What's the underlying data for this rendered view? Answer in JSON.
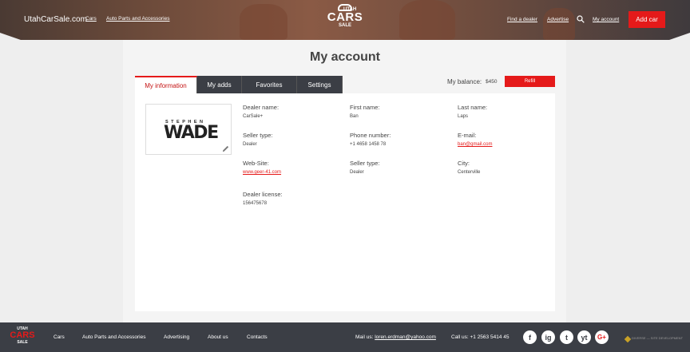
{
  "header": {
    "site_name": "UtahCarSale.com",
    "nav": [
      "Cars",
      "Auto Parts and Accessories"
    ],
    "logo": {
      "top": "UTAH",
      "main": "CARS",
      "bottom": "SALE"
    },
    "right_nav": {
      "find_dealer": "Find a dealer",
      "advertise": "Advertise",
      "my_account": "My account"
    },
    "add_car_label": "Add car"
  },
  "page": {
    "title": "My account"
  },
  "tabs": [
    {
      "label": "My information",
      "active": true
    },
    {
      "label": "My adds"
    },
    {
      "label": "Favorites"
    },
    {
      "label": "Settings"
    }
  ],
  "balance": {
    "label": "My balance:",
    "value": "$450",
    "refill_label": "Refill"
  },
  "avatar": {
    "top_text": "STEPHEN",
    "main_text": "WADE"
  },
  "fields": {
    "dealer_name": {
      "label": "Dealer name:",
      "value": "CarSale+"
    },
    "first_name": {
      "label": "First name:",
      "value": "Ban"
    },
    "last_name": {
      "label": "Last name:",
      "value": "Laps"
    },
    "seller_type_1": {
      "label": "Seller type:",
      "value": "Dealer"
    },
    "phone": {
      "label": "Phone number:",
      "value": "+1 4658 1458 78"
    },
    "email": {
      "label": "E-mail:",
      "value": "ban@gmail.com"
    },
    "website": {
      "label": "Web-Site:",
      "value": "www.geer-41.com"
    },
    "seller_type_2": {
      "label": "Seller type:",
      "value": "Dealer"
    },
    "city": {
      "label": "City:",
      "value": "Centerville"
    },
    "dealer_license": {
      "label": "Dealer license:",
      "value": "156475678"
    }
  },
  "footer": {
    "logo": {
      "top": "UTAH",
      "main": "CARS",
      "bottom": "SALE"
    },
    "nav": [
      "Cars",
      "Auto Parts and Accessories",
      "Advertising",
      "About us",
      "Contacts"
    ],
    "mail_label": "Mail us:",
    "mail_value": "loren.erdman@yahoo.com",
    "call": "Call us: +1 2563 5414 45",
    "social": [
      "f",
      "ig",
      "t",
      "yt",
      "G+"
    ],
    "credit": "DIVERSE — SITE DEVELOPMENT"
  },
  "colors": {
    "accent": "#e51a1a",
    "dark": "#3b3e45"
  }
}
